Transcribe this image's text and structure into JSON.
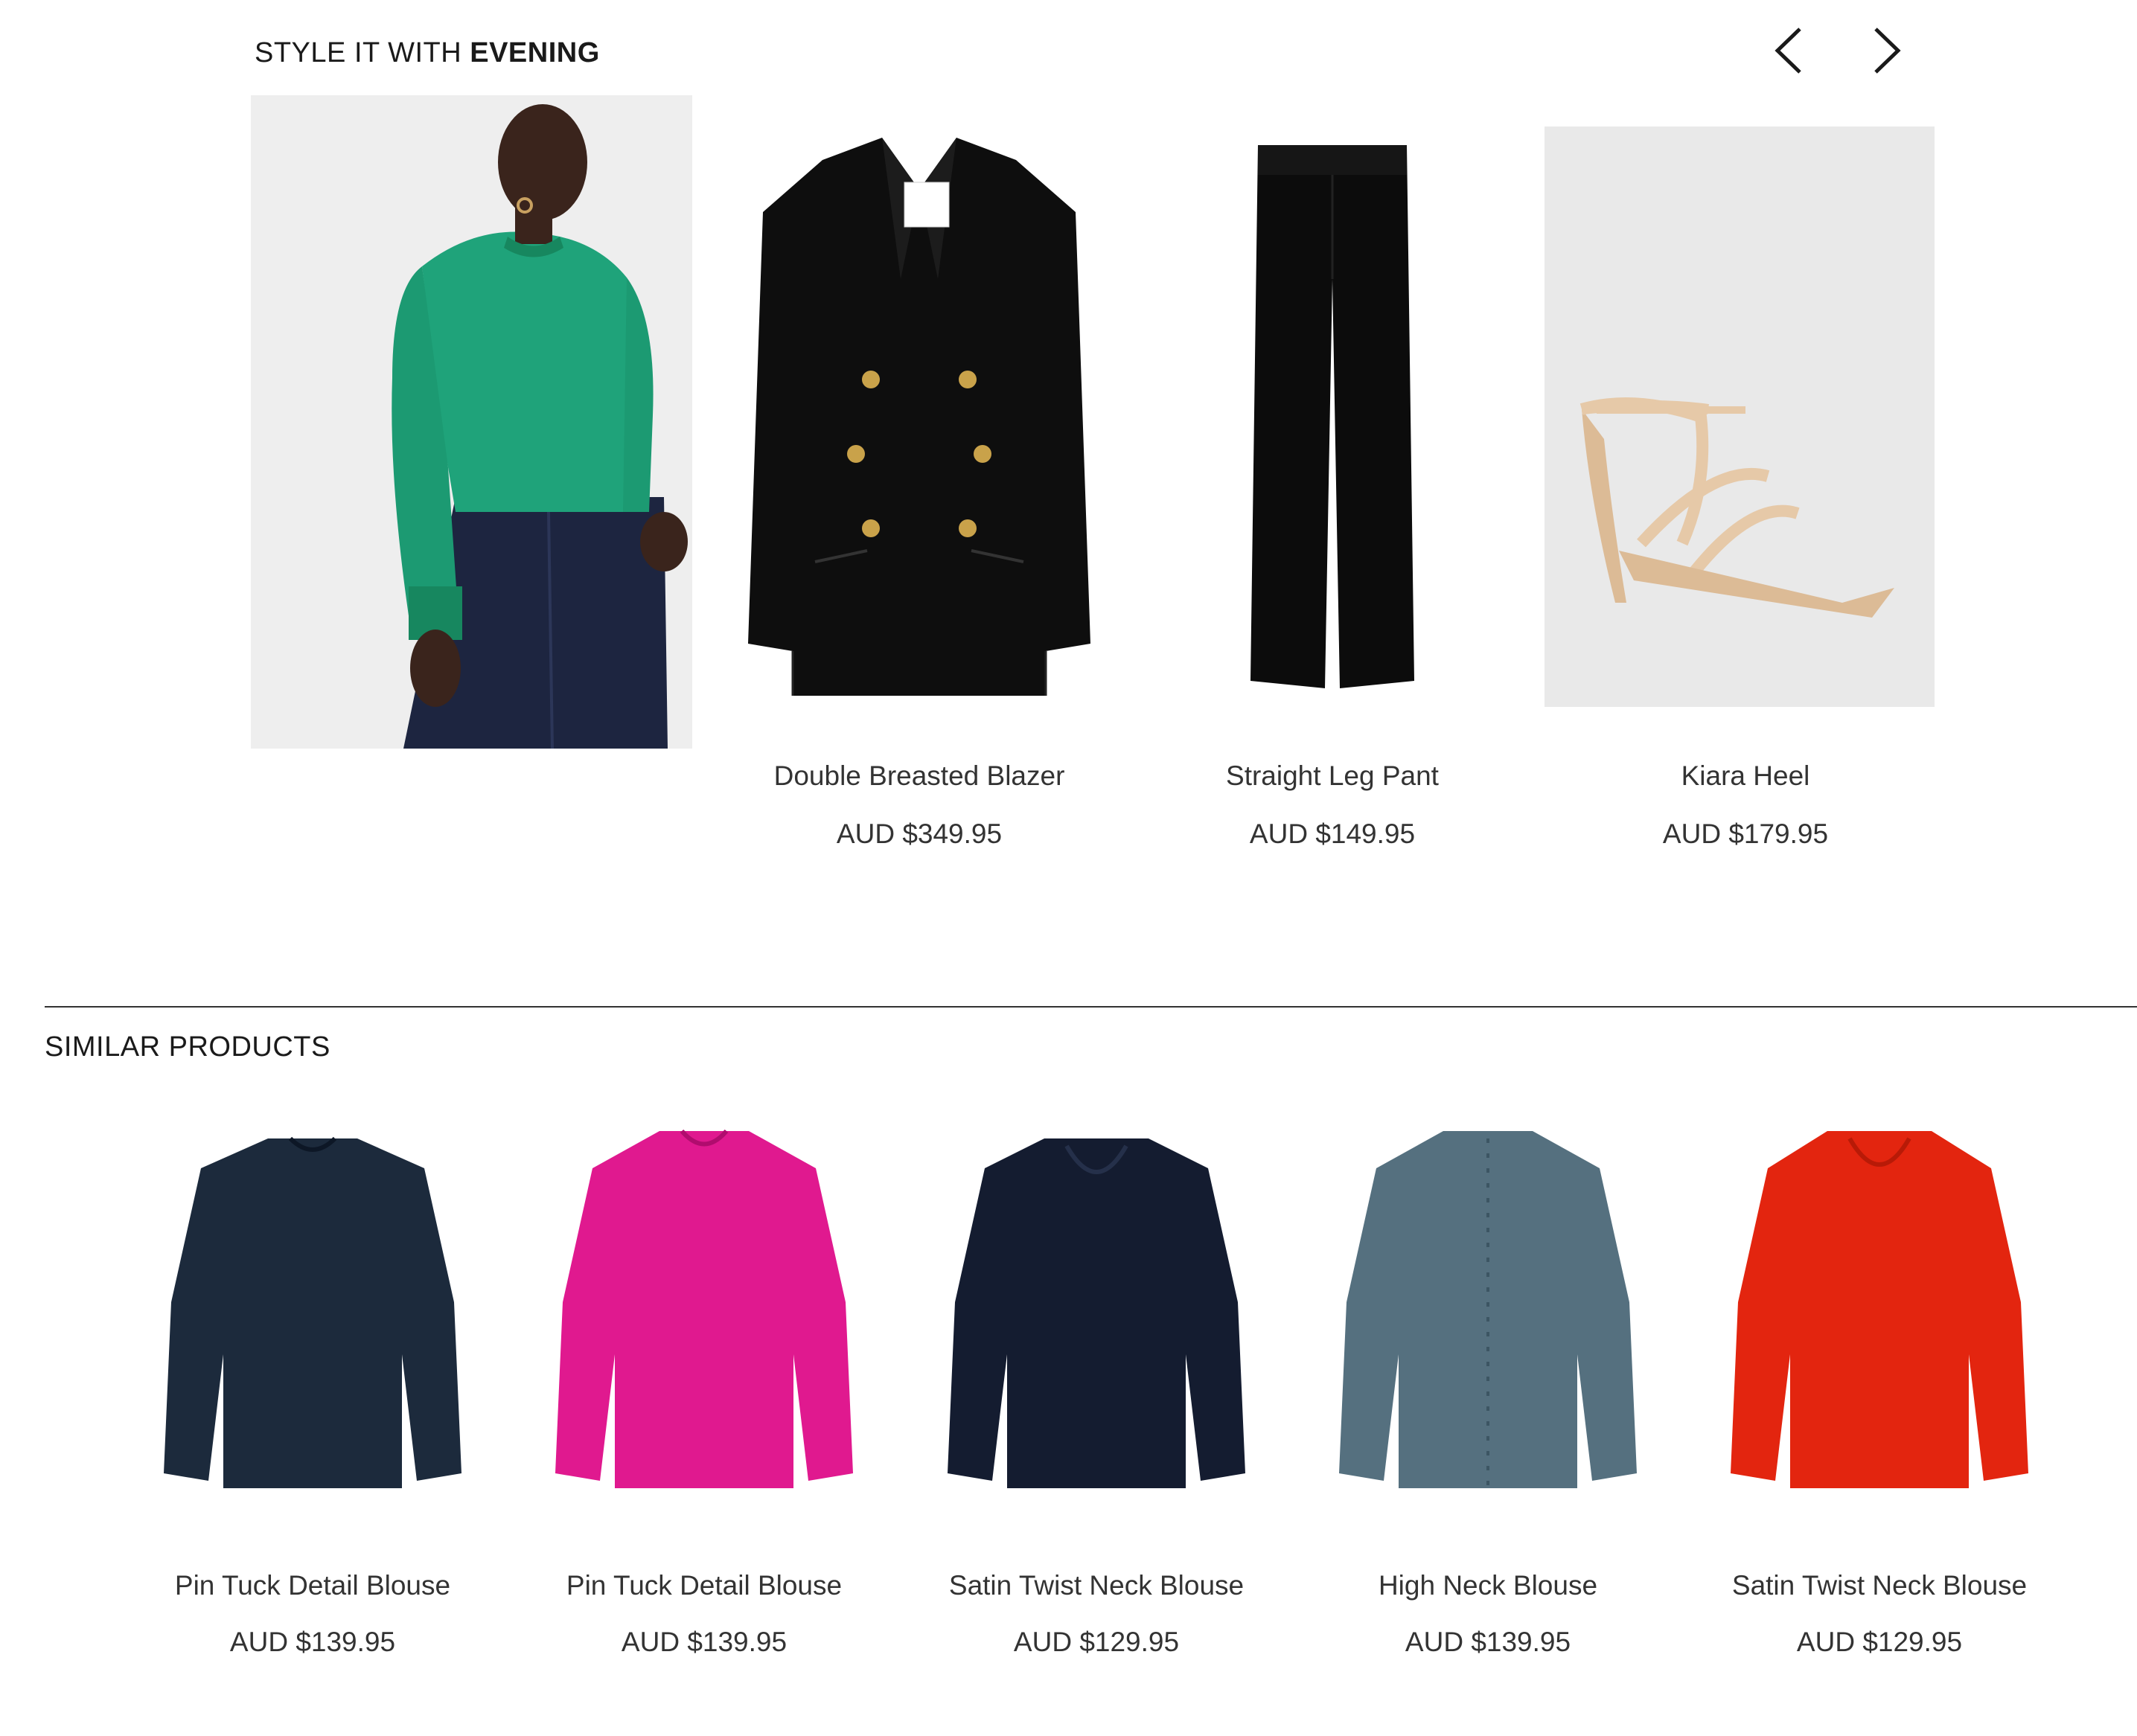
{
  "style_section": {
    "title_prefix": "STYLE IT WITH ",
    "title_emphasis": "EVENING",
    "hero_image_icon": "model-green-blouse-image",
    "items": [
      {
        "name": "Double Breasted Blazer",
        "price": "AUD $349.95",
        "icon": "black-blazer-image"
      },
      {
        "name": "Straight Leg Pant",
        "price": "AUD $149.95",
        "icon": "black-pant-image"
      },
      {
        "name": "Kiara Heel",
        "price": "AUD $179.95",
        "icon": "nude-heel-image"
      }
    ]
  },
  "similar_section": {
    "title": "SIMILAR PRODUCTS",
    "items": [
      {
        "name": "Pin Tuck Detail Blouse",
        "price": "AUD $139.95",
        "color": "#1c2a3c"
      },
      {
        "name": "Pin Tuck Detail Blouse",
        "price": "AUD $139.95",
        "color": "#e0198f"
      },
      {
        "name": "Satin Twist Neck Blouse",
        "price": "AUD $129.95",
        "color": "#141c30"
      },
      {
        "name": "High Neck Blouse",
        "price": "AUD $139.95",
        "color": "#55707f"
      },
      {
        "name": "Satin Twist Neck Blouse",
        "price": "AUD $129.95",
        "color": "#e3250f"
      }
    ]
  },
  "colors": {
    "hero_blouse": "#1fa37a",
    "hero_jeans": "#1d2540",
    "heel": "#e6c9a8"
  }
}
